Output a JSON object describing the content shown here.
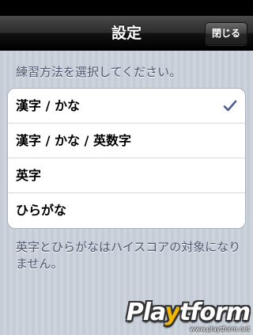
{
  "nav": {
    "title": "設定",
    "close_label": "閉じる"
  },
  "section_header": "練習方法を選択してください。",
  "options": [
    {
      "label": "漢字 / かな",
      "selected": true
    },
    {
      "label": "漢字 / かな / 英数字",
      "selected": false
    },
    {
      "label": "英字",
      "selected": false
    },
    {
      "label": "ひらがな",
      "selected": false
    }
  ],
  "footer_note": "英字とひらがなはハイスコアの対象になりません。",
  "icons": {
    "checkmark": "check-icon"
  },
  "colors": {
    "check": "#4a5f8f",
    "nav_background": "#000000",
    "section_text": "#4c566c"
  },
  "watermark": {
    "logo_prefix": "Pla",
    "logo_accent": "y",
    "logo_suffix": "tform",
    "url": "www.playtform.net"
  }
}
